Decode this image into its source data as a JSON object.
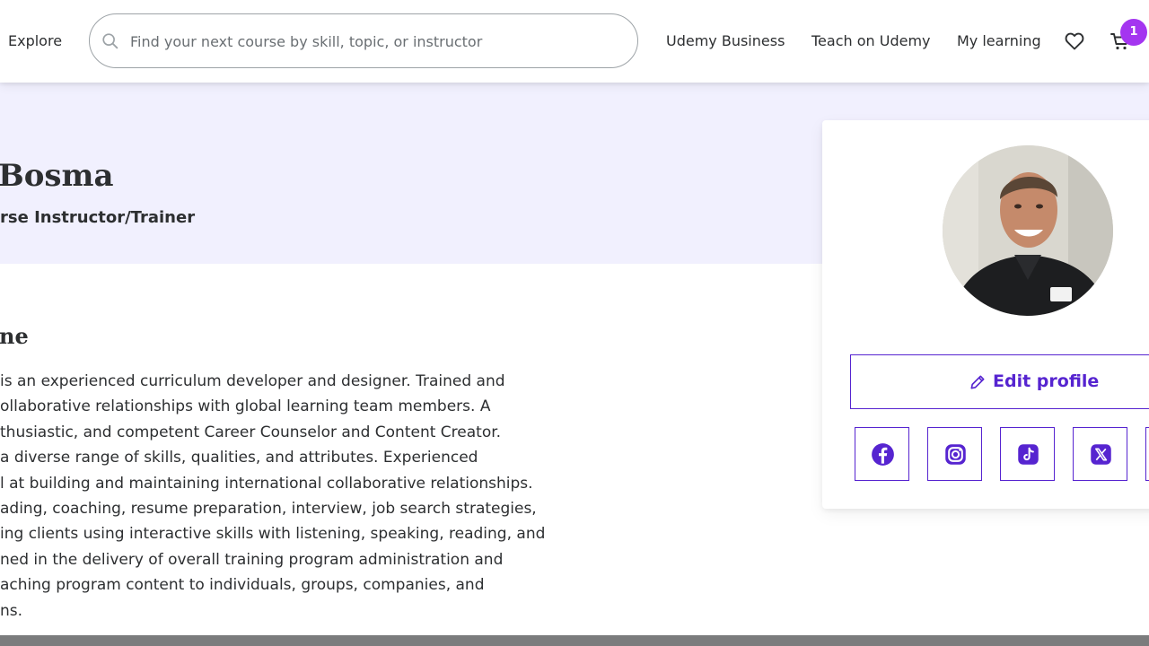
{
  "header": {
    "explore_label": "Explore",
    "search_placeholder": "Find your next course by skill, topic, or instructor",
    "nav": {
      "business": "Udemy Business",
      "teach": "Teach on Udemy",
      "my_learning": "My learning"
    },
    "cart_count": "1",
    "icons": [
      "search-icon",
      "heart-icon",
      "cart-icon"
    ]
  },
  "profile": {
    "name_visible": "Bosma",
    "headline_visible": "rse Instructor/Trainer",
    "about_heading_visible": "ne",
    "about_lines": [
      " is an experienced curriculum developer and designer. Trained and",
      "ollaborative relationships with global learning team members. A",
      "thusiastic, and competent Career Counselor and Content Creator.",
      " a diverse range of skills, qualities, and attributes. Experienced",
      "l at building and maintaining international collaborative relationships.",
      "ading, coaching, resume preparation, interview, job search strategies,",
      "ing clients using interactive skills with listening, speaking, reading, and",
      "ned in the delivery of overall training program administration and",
      "aching program content to individuals, groups, companies, and",
      "ns."
    ]
  },
  "card": {
    "edit_profile_label": "Edit profile",
    "social_icons": [
      "facebook-icon",
      "instagram-icon",
      "tiktok-icon",
      "x-icon"
    ]
  },
  "colors": {
    "accent": "#5624d0",
    "badge": "#a435f0",
    "hero_bg": "#f1f0fe",
    "text": "#2d2f31"
  }
}
